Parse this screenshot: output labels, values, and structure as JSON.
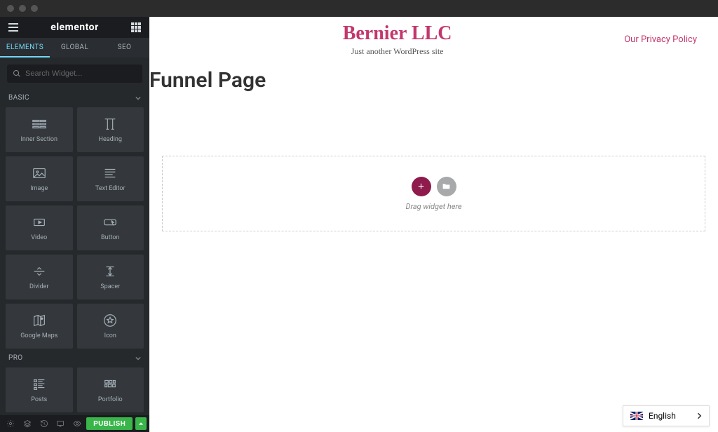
{
  "logo": "elementor",
  "tabs": {
    "elements": "ELEMENTS",
    "global": "GLOBAL",
    "seo": "SEO"
  },
  "search": {
    "placeholder": "Search Widget..."
  },
  "categories": {
    "basic": "BASIC",
    "pro": "PRO"
  },
  "widgets": {
    "basic": [
      {
        "key": "inner-section",
        "label": "Inner Section"
      },
      {
        "key": "heading",
        "label": "Heading"
      },
      {
        "key": "image",
        "label": "Image"
      },
      {
        "key": "text-editor",
        "label": "Text Editor"
      },
      {
        "key": "video",
        "label": "Video"
      },
      {
        "key": "button",
        "label": "Button"
      },
      {
        "key": "divider",
        "label": "Divider"
      },
      {
        "key": "spacer",
        "label": "Spacer"
      },
      {
        "key": "google-maps",
        "label": "Google Maps"
      },
      {
        "key": "icon",
        "label": "Icon"
      }
    ],
    "pro": [
      {
        "key": "posts",
        "label": "Posts"
      },
      {
        "key": "portfolio",
        "label": "Portfolio"
      }
    ]
  },
  "footer": {
    "publish": "PUBLISH"
  },
  "site": {
    "title": "Bernier LLC",
    "tagline": "Just another WordPress site",
    "nav": {
      "privacy": "Our Privacy Policy"
    }
  },
  "page": {
    "title": "Funnel Page"
  },
  "dropzone": {
    "hint": "Drag widget here"
  },
  "language": {
    "label": "English"
  }
}
